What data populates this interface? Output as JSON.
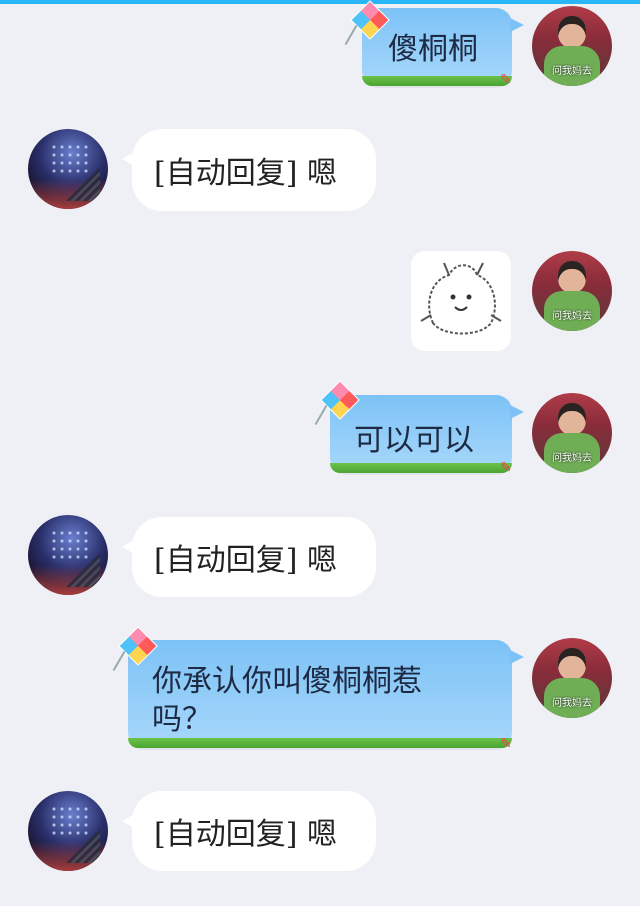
{
  "messages": [
    {
      "side": "right",
      "type": "text",
      "text": "傻桐桐"
    },
    {
      "side": "left",
      "type": "text",
      "text": "[自动回复] 嗯"
    },
    {
      "side": "right",
      "type": "sticker",
      "sticker": "cartoon-bun-face"
    },
    {
      "side": "right",
      "type": "text",
      "text": "可以可以"
    },
    {
      "side": "left",
      "type": "text",
      "text": "[自动回复] 嗯"
    },
    {
      "side": "right",
      "type": "text",
      "line1": "你承认你叫傻桐桐惹",
      "line2": "吗？"
    },
    {
      "side": "left",
      "type": "text",
      "text": "[自动回复] 嗯"
    }
  ],
  "avatar_right_caption": "问我妈去",
  "colors": {
    "bubble_blue": "#7cc2f6",
    "grass": "#6cc24a",
    "bubble_white": "#ffffff",
    "background": "#eef0f5",
    "top_bar": "#29b6f6"
  },
  "icons": [
    "kite-icon"
  ]
}
